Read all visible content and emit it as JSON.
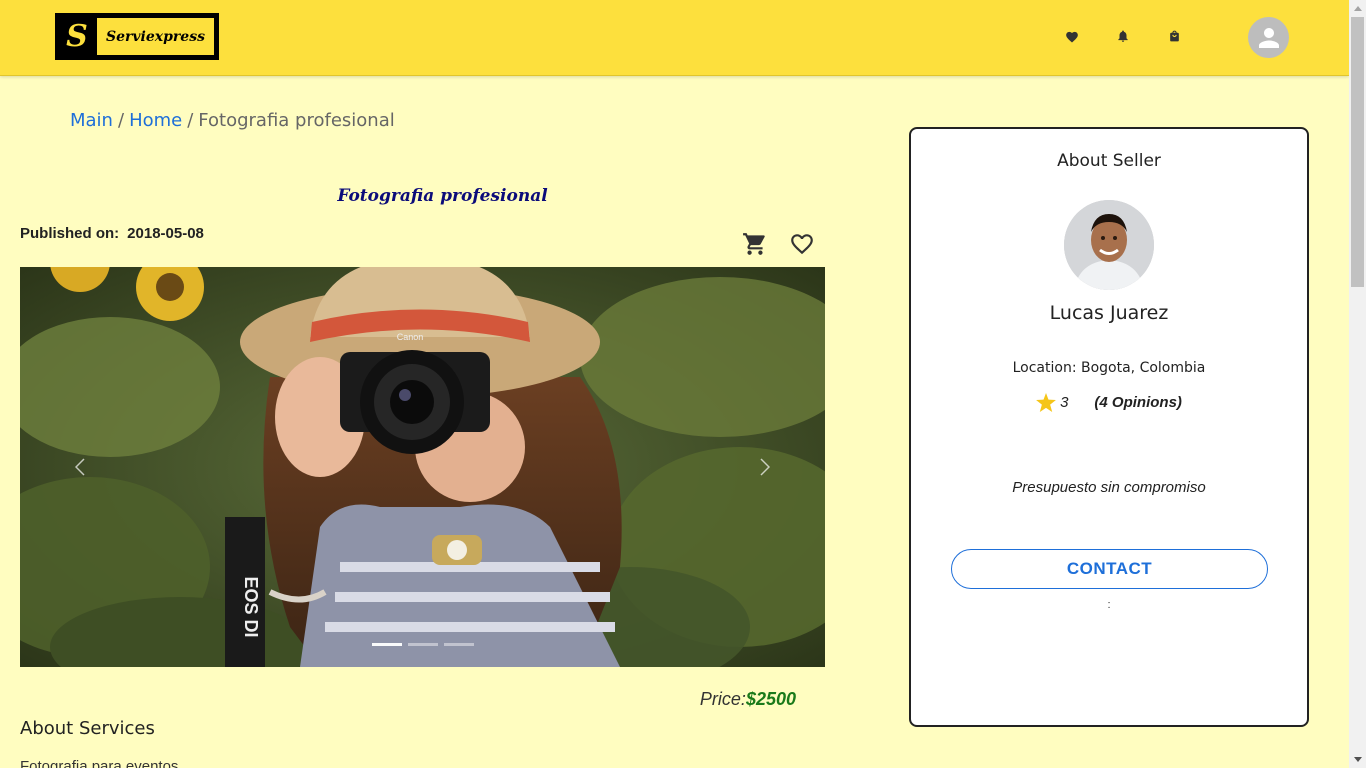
{
  "header": {
    "logo_mark": "S",
    "logo_text": "Serviexpress",
    "icons": [
      "heart-icon",
      "bell-icon",
      "shopping-bag-icon",
      "account-icon"
    ],
    "accent": "#fde03d"
  },
  "breadcrumb": {
    "items": [
      "Main",
      "Home",
      "Fotografia profesional"
    ],
    "separator": "/"
  },
  "service": {
    "title": "Fotografia profesional",
    "published_label": "Published on:",
    "published_date": "2018-05-08",
    "price_label": "Price:",
    "price_value": "$2500",
    "about_label": "About Services",
    "description": "Fotografia para eventos"
  },
  "carousel": {
    "slides": 3,
    "active_slide": 1,
    "camera_brand": "Canon",
    "strap_text": "EOS DI"
  },
  "seller": {
    "heading": "About Seller",
    "name": "Lucas Juarez",
    "location": "Location: Bogota, Colombia",
    "rating": "3",
    "opinions": "(4 Opinions)",
    "tagline": "Presupuesto sin compromiso",
    "contact_label": "CONTACT",
    "footer_text": ":"
  },
  "colors": {
    "background": "#fffdc0",
    "link": "#1e6fd9",
    "title": "#0b0b7a",
    "price": "#1a7a1a",
    "star": "#f5c518"
  }
}
